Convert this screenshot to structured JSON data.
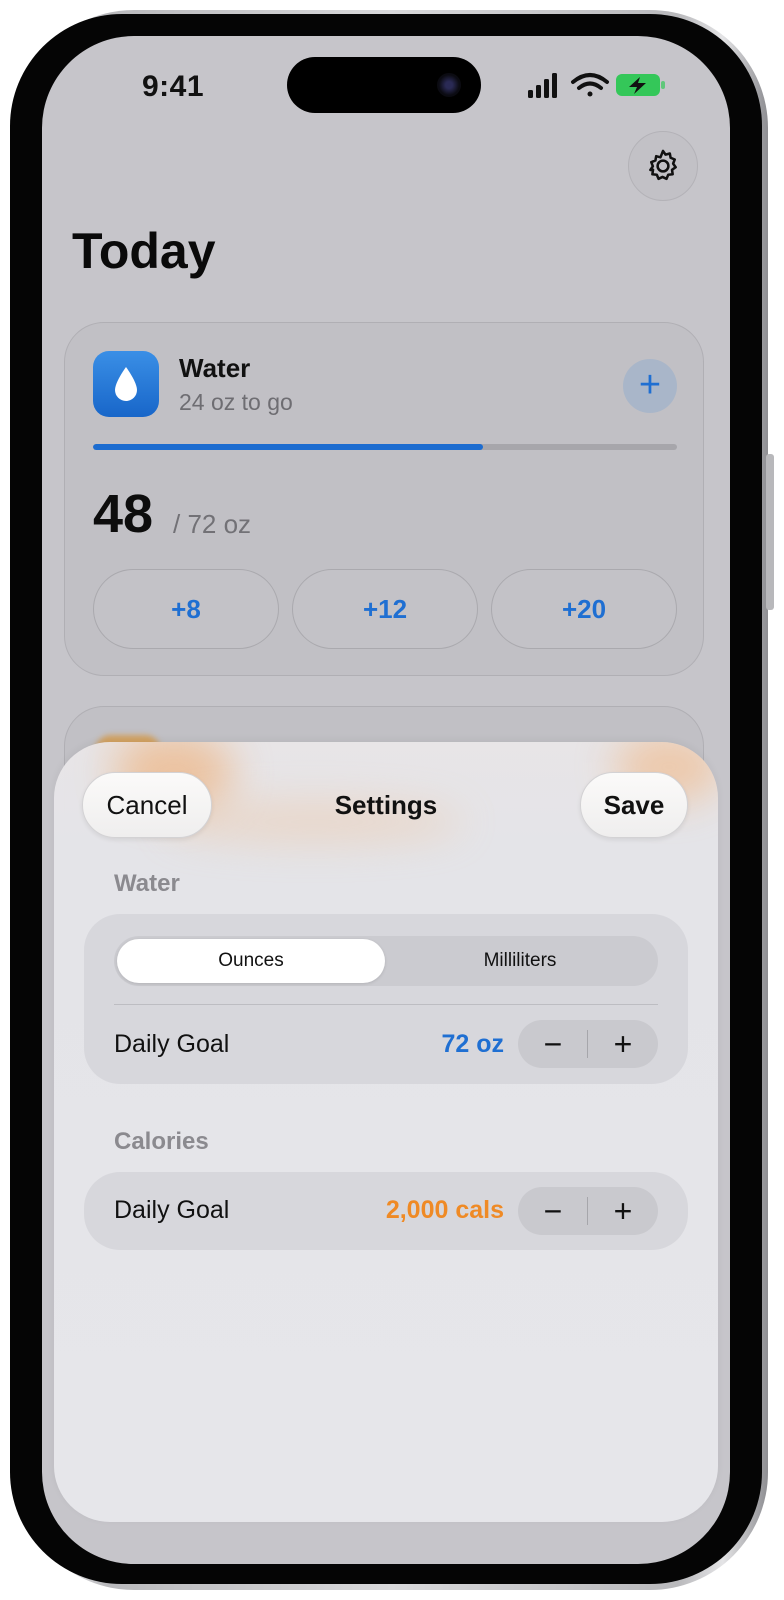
{
  "status_bar": {
    "time": "9:41"
  },
  "app": {
    "title": "Today",
    "settings_icon": "gear-icon",
    "water_card": {
      "title": "Water",
      "subtitle": "24 oz to go",
      "icon": "water-drop-icon",
      "add_label": "+",
      "progress": 0.667,
      "amount": "48",
      "goal_text": "/ 72 oz",
      "quick_adds": [
        "+8",
        "+12",
        "+20"
      ]
    }
  },
  "sheet": {
    "cancel_label": "Cancel",
    "title": "Settings",
    "save_label": "Save",
    "water_section": {
      "label": "Water",
      "units": [
        "Ounces",
        "Milliliters"
      ],
      "selected_unit": "Ounces",
      "daily_goal_label": "Daily Goal",
      "daily_goal_value": "72 oz",
      "minus": "−",
      "plus": "+"
    },
    "calories_section": {
      "label": "Calories",
      "daily_goal_label": "Daily Goal",
      "daily_goal_value": "2,000 cals",
      "minus": "−",
      "plus": "+"
    }
  },
  "colors": {
    "accent_blue": "#1f6fd2",
    "accent_orange": "#ef8a25",
    "battery_green": "#34c759"
  }
}
